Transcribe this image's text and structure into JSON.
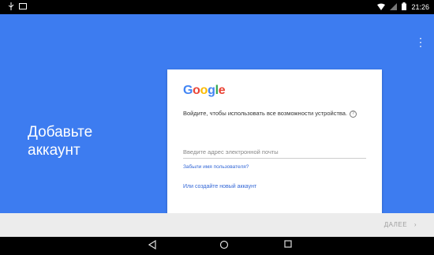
{
  "status_bar": {
    "time": "21:26"
  },
  "page": {
    "title": "Добавьте аккаунт"
  },
  "card": {
    "logo": {
      "G": "G",
      "o1": "o",
      "o2": "o",
      "g": "g",
      "l": "l",
      "e": "e"
    },
    "description": "Войдите, чтобы использовать все возможности устройства.",
    "email_placeholder": "Введите адрес электронной почты",
    "forgot_link": "Забыли имя пользователя?",
    "create_link": "Или создайте новый аккаунт"
  },
  "bottom_bar": {
    "next_label": "ДАЛЕЕ"
  },
  "colors": {
    "primary_blue": "#3d7cf0",
    "link_blue": "#3367d6",
    "google_blue": "#4285f4",
    "google_red": "#ea4335",
    "google_yellow": "#fbbc05",
    "google_green": "#34a853"
  },
  "icons": [
    "usb-icon",
    "screenshot-icon",
    "wifi-icon",
    "signal-icon",
    "battery-icon",
    "overflow-menu-icon",
    "info-icon",
    "chevron-right-icon",
    "back-icon",
    "home-icon",
    "recents-icon"
  ]
}
